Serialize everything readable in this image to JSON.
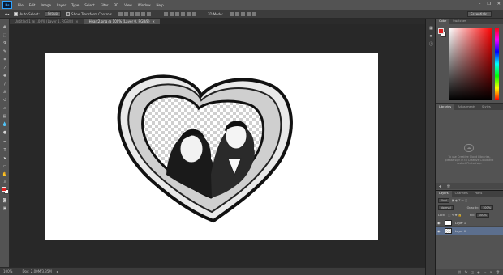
{
  "app": {
    "logo_text": "Ps",
    "menu": [
      "File",
      "Edit",
      "Image",
      "Layer",
      "Type",
      "Select",
      "Filter",
      "3D",
      "View",
      "Window",
      "Help"
    ],
    "window_controls": [
      "–",
      "❐",
      "✕"
    ]
  },
  "options_bar": {
    "auto_select_label": "Auto-Select:",
    "auto_select_value": "Group",
    "show_transform_label": "Show Transform Controls",
    "mode_3d_label": "3D Mode:",
    "workspace": "Essentials"
  },
  "tabs": [
    {
      "label": "Untitled-1 @ 100% (Layer 1, RGB/8)",
      "close": "×"
    },
    {
      "label": "Heart2.png @ 100% (Layer 0, RGB/8)",
      "close": "×"
    }
  ],
  "status": {
    "zoom": "100%",
    "doc_size": "Doc: 2.00M/3.35M",
    "arrow": "▸"
  },
  "panels": {
    "color_tabs": [
      "Color",
      "Swatches"
    ],
    "library_tabs": [
      "Libraries",
      "Adjustments",
      "Styles"
    ],
    "library_message": "To use Creative Cloud Libraries, please sign in to Creative Cloud and restart Photoshop.",
    "layers_tabs": [
      "Layers",
      "Channels",
      "Paths"
    ],
    "kind_label": "Kind",
    "blend_mode": "Normal",
    "opacity_label": "Opacity:",
    "opacity_value": "100%",
    "lock_label": "Lock:",
    "fill_label": "Fill:",
    "fill_value": "100%",
    "layers": [
      {
        "name": "Layer 1",
        "visible": true,
        "selected": false
      },
      {
        "name": "Layer 0",
        "visible": true,
        "selected": true
      }
    ]
  },
  "colors": {
    "foreground": "#e02020",
    "background": "#ffffff",
    "selection": "#5c6f8e"
  }
}
